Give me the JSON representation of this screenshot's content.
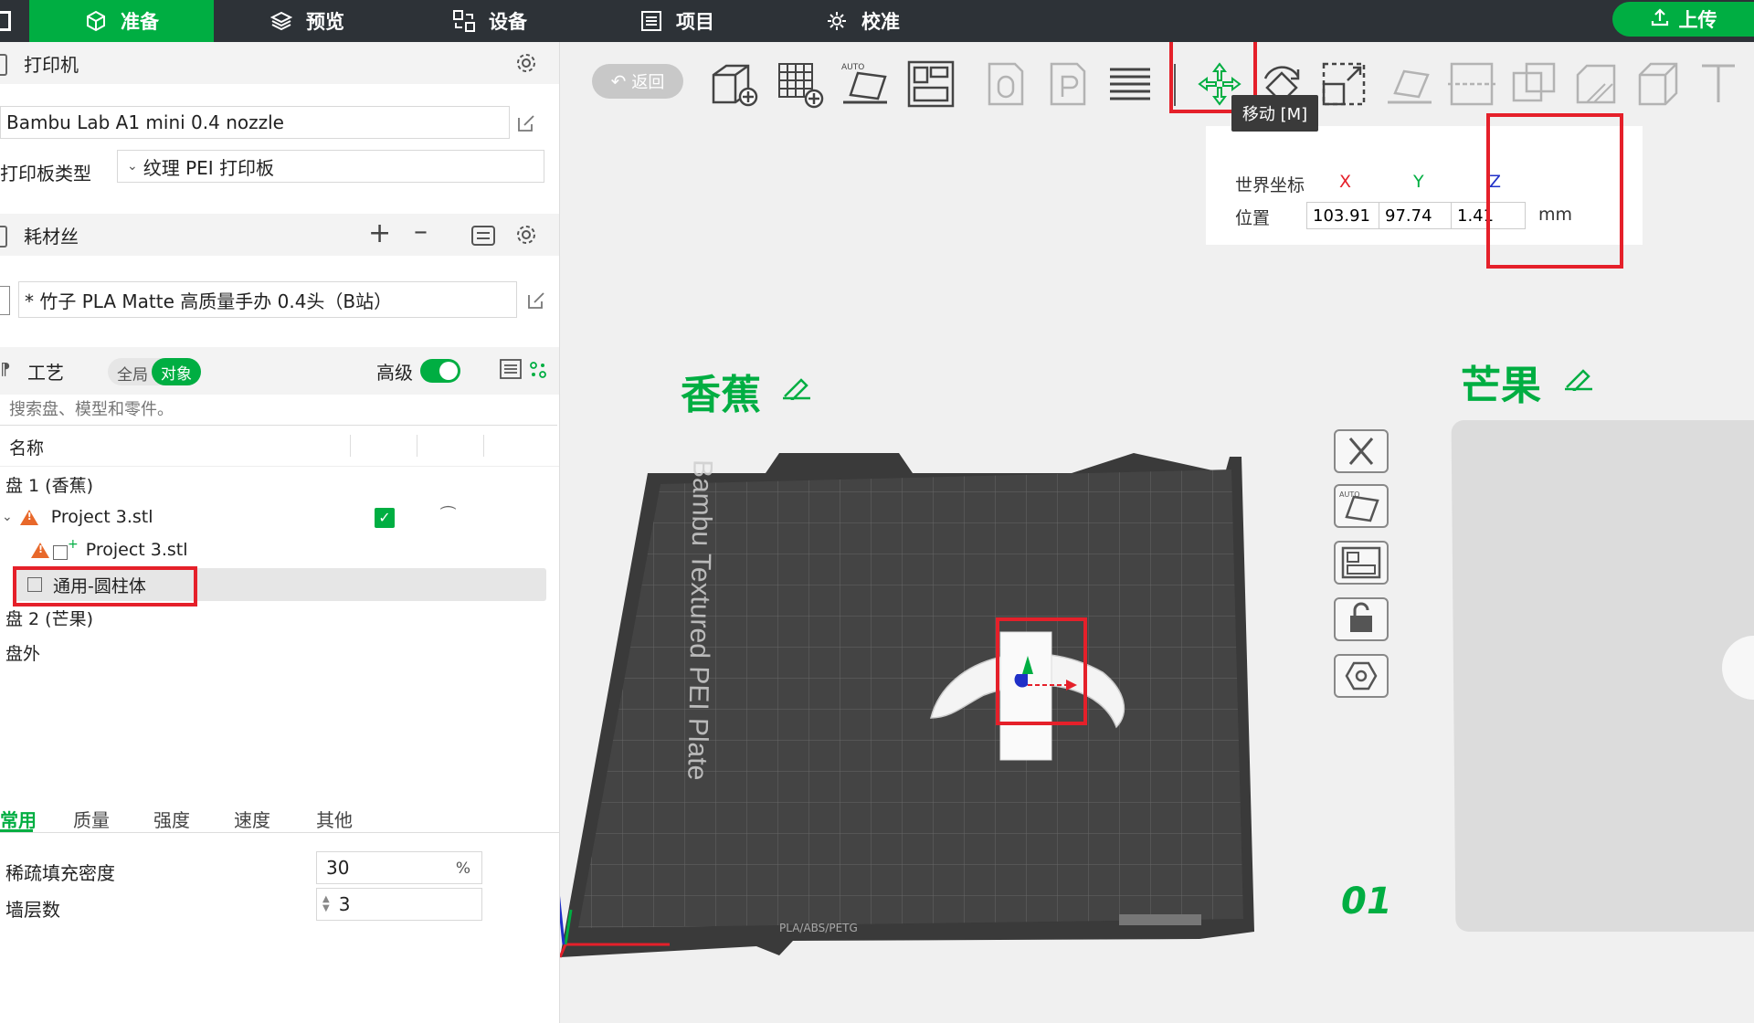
{
  "nav": {
    "tabs": [
      {
        "label": "准备",
        "icon": "cube-icon",
        "active": true
      },
      {
        "label": "预览",
        "icon": "layers-icon",
        "active": false
      },
      {
        "label": "设备",
        "icon": "device-icon",
        "active": false
      },
      {
        "label": "项目",
        "icon": "list-icon",
        "active": false
      },
      {
        "label": "校准",
        "icon": "calibrate-icon",
        "active": false
      }
    ],
    "upload_label": "上传"
  },
  "printer": {
    "section_title": "打印机",
    "model": "Bambu Lab A1 mini 0.4 nozzle",
    "plate_type_label": "打印板类型",
    "plate_type_value": "纹理 PEI 打印板"
  },
  "filament": {
    "section_title": "耗材丝",
    "value": "* 竹子 PLA Matte 高质量手办 0.4头（B站）"
  },
  "process": {
    "section_title": "工艺",
    "scope_global": "全局",
    "scope_object": "对象",
    "advanced_label": "高级",
    "search_placeholder": "搜索盘、模型和零件。",
    "column_name": "名称"
  },
  "tree": {
    "plate1": "盘 1 (香蕉)",
    "object": "Project 3.stl",
    "part": "Project 3.stl",
    "modifier": "通用-圆柱体",
    "plate2": "盘 2 (芒果)",
    "outside": "盘外"
  },
  "param_tabs": [
    "常用",
    "质量",
    "强度",
    "速度",
    "其他"
  ],
  "params": {
    "infill_label": "稀疏填充密度",
    "infill_value": "30",
    "infill_unit": "%",
    "walls_label": "墙层数",
    "walls_value": "3"
  },
  "viewport": {
    "back_label": "返回",
    "tooltip": "移动 [M]",
    "coord_title": "世界坐标",
    "position_label": "位置",
    "axis_x": "X",
    "axis_y": "Y",
    "axis_z": "Z",
    "pos_x": "103.91",
    "pos_y": "97.74",
    "pos_z": "1.41",
    "unit": "mm",
    "plate1_name": "香蕉",
    "plate2_name": "芒果",
    "plate_brand": "Bambu Textured PEI Plate",
    "plate_number": "01",
    "plate_footer": "PLA/ABS/PETG"
  },
  "colors": {
    "accent": "#00ae42",
    "highlight": "#e5202a",
    "nav_bg": "#2d3237"
  }
}
